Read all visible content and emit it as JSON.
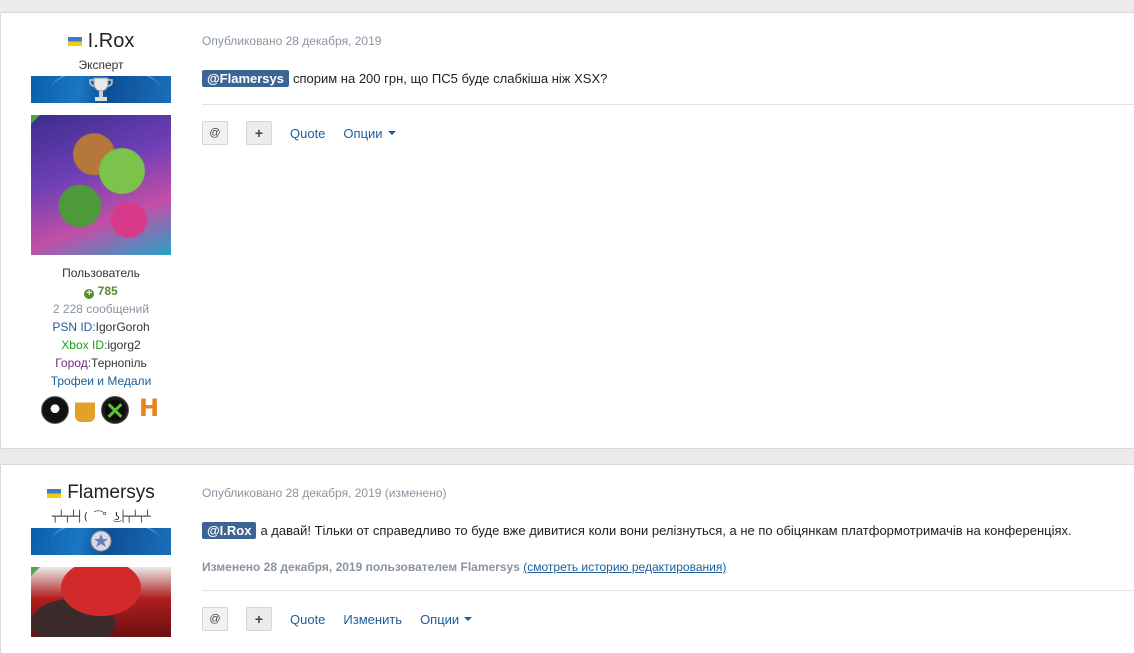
{
  "posts": [
    {
      "author": {
        "name": "I.Rox",
        "title": "Эксперт",
        "group": "Пользователь",
        "reputation": "785",
        "posts_count": "2 228 сообщений",
        "psn_label": "PSN ID:",
        "psn_value": "IgorGoroh",
        "xbox_label": "Xbox ID:",
        "xbox_value": "igorg2",
        "city_label": "Город:",
        "city_value": "Тернопіль",
        "trophies_link": "Трофеи и Медали",
        "badges": [
          "agent-badge-icon",
          "beer-badge-icon",
          "xbox-badge-icon",
          "h-badge-icon"
        ]
      },
      "date": "Опубликовано 28 декабря, 2019",
      "mention": "@Flamersys",
      "text": "спорим на 200 грн, що ПС5 буде слабкіша ніж XSX?",
      "actions": {
        "mention_icon": "@",
        "plus_icon": "+",
        "quote": "Quote",
        "options": "Опции"
      }
    },
    {
      "author": {
        "name": "Flamersys",
        "signature": "┬┴┬┴┤( ͡° ͜ʖ├┬┴┬┴"
      },
      "date": "Опубликовано 28 декабря, 2019 (изменено)",
      "mention": "@I.Rox",
      "text": "а давай! Тільки от справедливо то буде вже дивитися коли вони релізнуться, а не по обіцянкам платформотримачів на конференціях.",
      "edited": "Изменено 28 декабря, 2019 пользователем Flamersys",
      "history_link": "(смотреть историю редактирования)",
      "actions": {
        "mention_icon": "@",
        "plus_icon": "+",
        "quote": "Quote",
        "edit": "Изменить",
        "options": "Опции"
      }
    }
  ],
  "colors": {
    "mention_bg": "#3d6594",
    "link": "#1b5e9b",
    "reputation": "#5a8a2e",
    "xbox": "#1ba01b"
  }
}
